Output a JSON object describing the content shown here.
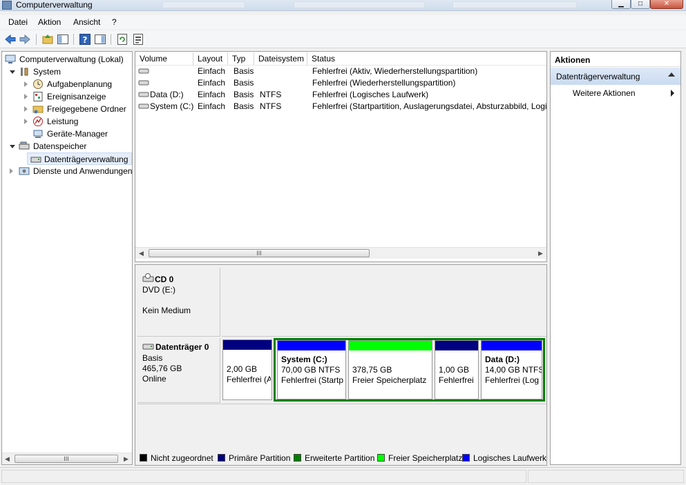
{
  "window": {
    "title": "Computerverwaltung"
  },
  "menubar": {
    "items": [
      "Datei",
      "Aktion",
      "Ansicht",
      "?"
    ]
  },
  "tree": {
    "items": [
      {
        "label": "Computerverwaltung (Lokal)"
      },
      {
        "label": "System"
      },
      {
        "label": "Aufgabenplanung"
      },
      {
        "label": "Ereignisanzeige"
      },
      {
        "label": "Freigegebene Ordner"
      },
      {
        "label": "Leistung"
      },
      {
        "label": "Geräte-Manager"
      },
      {
        "label": "Datenspeicher"
      },
      {
        "label": "Datenträgerverwaltung"
      },
      {
        "label": "Dienste und Anwendungen"
      }
    ],
    "scroll_label": "III"
  },
  "volumes": {
    "columns": [
      "Volume",
      "Layout",
      "Typ",
      "Dateisystem",
      "Status"
    ],
    "rows": [
      {
        "volume": "",
        "layout": "Einfach",
        "type": "Basis",
        "fs": "",
        "status": "Fehlerfrei (Aktiv, Wiederherstellungspartition)"
      },
      {
        "volume": "",
        "layout": "Einfach",
        "type": "Basis",
        "fs": "",
        "status": "Fehlerfrei (Wiederherstellungspartition)"
      },
      {
        "volume": "Data (D:)",
        "layout": "Einfach",
        "type": "Basis",
        "fs": "NTFS",
        "status": "Fehlerfrei (Logisches Laufwerk)"
      },
      {
        "volume": "System (C:)",
        "layout": "Einfach",
        "type": "Basis",
        "fs": "NTFS",
        "status": "Fehlerfrei (Startpartition, Auslagerungsdatei, Absturzabbild, Logis"
      }
    ],
    "scroll_label": "III"
  },
  "disks": {
    "cd": {
      "name": "CD 0",
      "type": "DVD (E:)",
      "state": "Kein Medium"
    },
    "disk0": {
      "name": "Datenträger 0",
      "kind": "Basis",
      "size": "465,76 GB",
      "state": "Online",
      "partitions": [
        {
          "name": "",
          "size": "2,00 GB",
          "status": "Fehlerfrei (A",
          "color": "#000080"
        },
        {
          "name": "System  (C:)",
          "size": "70,00 GB NTFS",
          "status": "Fehlerfrei (Startp",
          "color": "#0000ff"
        },
        {
          "name": "",
          "size": "378,75 GB",
          "status": "Freier Speicherplatz",
          "color": "#00ff00"
        },
        {
          "name": "",
          "size": "1,00 GB",
          "status": "Fehlerfrei",
          "color": "#000080"
        },
        {
          "name": "Data  (D:)",
          "size": "14,00 GB NTFS",
          "status": "Fehlerfrei (Log",
          "color": "#0000ff"
        }
      ]
    }
  },
  "legend": [
    {
      "label": "Nicht zugeordnet",
      "color": "#000000"
    },
    {
      "label": "Primäre Partition",
      "color": "#000080"
    },
    {
      "label": "Erweiterte Partition",
      "color": "#008000"
    },
    {
      "label": "Freier Speicherplatz",
      "color": "#00ff00"
    },
    {
      "label": "Logisches Laufwerk",
      "color": "#0000ff"
    }
  ],
  "actions": {
    "header": "Aktionen",
    "section": "Datenträgerverwaltung",
    "more": "Weitere Aktionen"
  }
}
